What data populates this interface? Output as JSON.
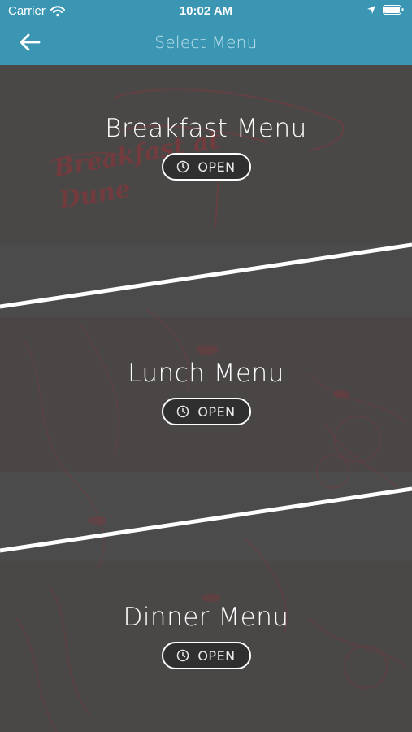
{
  "status_bar": {
    "carrier": "Carrier",
    "time": "10:02 AM",
    "icons": [
      "wifi-icon",
      "location-arrow-icon",
      "battery-icon"
    ]
  },
  "nav": {
    "title": "Select Menu",
    "back_icon": "arrow-left-icon"
  },
  "menus": [
    {
      "title": "Breakfast Menu",
      "button_label": "OPEN",
      "button_icon": "clock-icon"
    },
    {
      "title": "Lunch Menu",
      "button_label": "OPEN",
      "button_icon": "clock-icon"
    },
    {
      "title": "Dinner Menu",
      "button_label": "OPEN",
      "button_icon": "clock-icon"
    }
  ],
  "background_sign": "Breakfast at Dune",
  "colors": {
    "header": "#3b96b4",
    "panel": "#4b4b4b",
    "sketch": "#7a3a3e",
    "divider": "#ffffff",
    "button_bg": "#2f2f2f"
  }
}
